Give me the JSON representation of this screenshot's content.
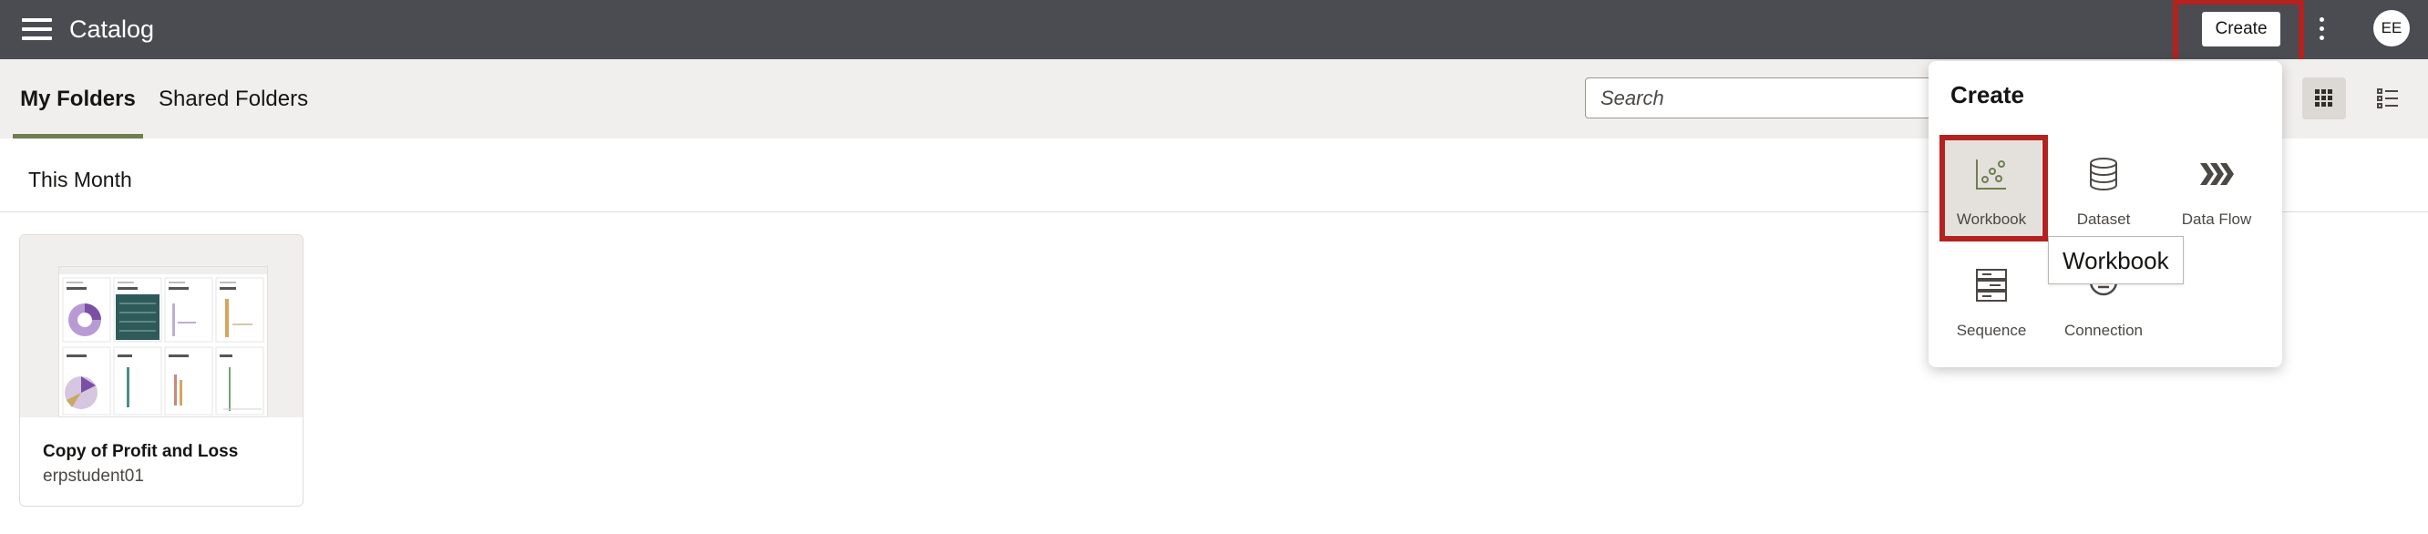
{
  "app": {
    "title": "Catalog"
  },
  "topbar": {
    "create_label": "Create",
    "avatar_initials": "EE"
  },
  "tabs": [
    {
      "label": "My Folders",
      "active": true
    },
    {
      "label": "Shared Folders",
      "active": false
    }
  ],
  "search": {
    "placeholder": "Search",
    "value": ""
  },
  "section": {
    "heading": "This Month"
  },
  "cards": [
    {
      "title": "Copy of Profit and Loss",
      "owner": "erpstudent01"
    }
  ],
  "create_menu": {
    "title": "Create",
    "items": [
      {
        "label": "Workbook",
        "icon": "workbook-icon"
      },
      {
        "label": "Dataset",
        "icon": "dataset-icon"
      },
      {
        "label": "Data Flow",
        "icon": "data-flow-icon"
      },
      {
        "label": "Sequence",
        "icon": "sequence-icon"
      },
      {
        "label": "Connection",
        "icon": "connection-icon"
      }
    ],
    "tooltip": "Workbook"
  },
  "colors": {
    "topbar": "#4a4c52",
    "subbar": "#f1efed",
    "highlight": "#b3221f",
    "accent": "#6f7e4e"
  }
}
